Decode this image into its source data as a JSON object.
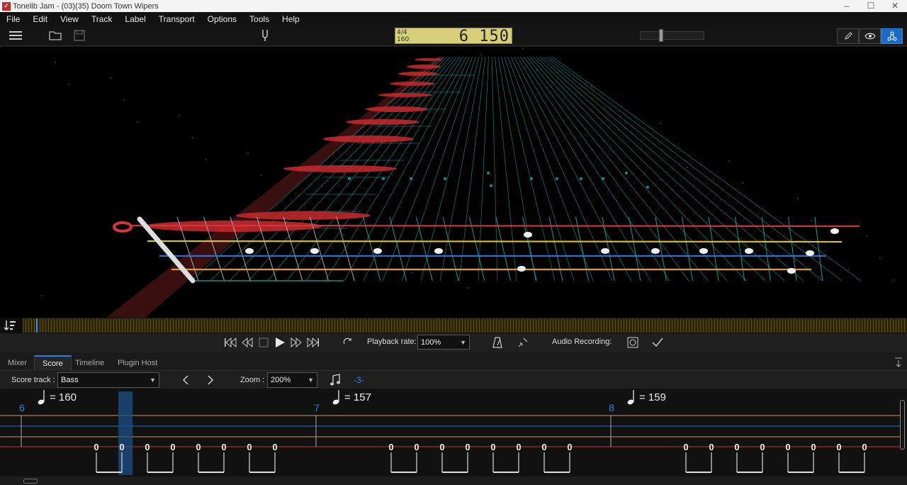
{
  "window": {
    "title": "Tonelib Jam - (03)(35) Doom Town  Wipers",
    "controls": [
      "–",
      "☐",
      "✕"
    ]
  },
  "menu": [
    "File",
    "Edit",
    "View",
    "Track",
    "Label",
    "Transport",
    "Options",
    "Tools",
    "Help"
  ],
  "lcd": {
    "time_signature": "4/4",
    "tempo": "160",
    "position": "6 150"
  },
  "volume": 0.3,
  "view_modes": [
    {
      "icon": "pencil-icon",
      "active": false
    },
    {
      "icon": "eye-icon",
      "active": false
    },
    {
      "icon": "network-icon",
      "active": true
    }
  ],
  "transport": {
    "playback_rate_label": "Playback rate:",
    "playback_rate_value": "100%",
    "audio_recording_label": "Audio Recording:"
  },
  "tabs": [
    "Mixer",
    "Score",
    "Timeline",
    "Plugin Host"
  ],
  "active_tab": "Score",
  "score_toolbar": {
    "score_track_label": "Score track :",
    "score_track_value": "Bass",
    "zoom_label": "Zoom :",
    "zoom_value": "200%",
    "triplet_label": "-3-"
  },
  "score": {
    "measures": [
      {
        "number": "6",
        "tempo": "= 160",
        "notes": [
          "0",
          "0",
          "0",
          "0",
          "0",
          "0",
          "0",
          "0"
        ]
      },
      {
        "number": "7",
        "tempo": "= 157",
        "notes": [
          "0",
          "0",
          "0",
          "0",
          "0",
          "0",
          "0",
          "0"
        ]
      },
      {
        "number": "8",
        "tempo": "= 159",
        "notes": [
          "0",
          "0",
          "0",
          "0",
          "0",
          "0",
          "0",
          "0"
        ]
      }
    ],
    "string_colors": [
      "#c8a030",
      "#2d6fd0",
      "#c8a030",
      "#c8323c"
    ]
  },
  "fretboard": {
    "string_colors": [
      "#d8343c",
      "#d8c030",
      "#2d6fd0",
      "#e09a28"
    ],
    "fret_color": "#1fa8a8"
  }
}
